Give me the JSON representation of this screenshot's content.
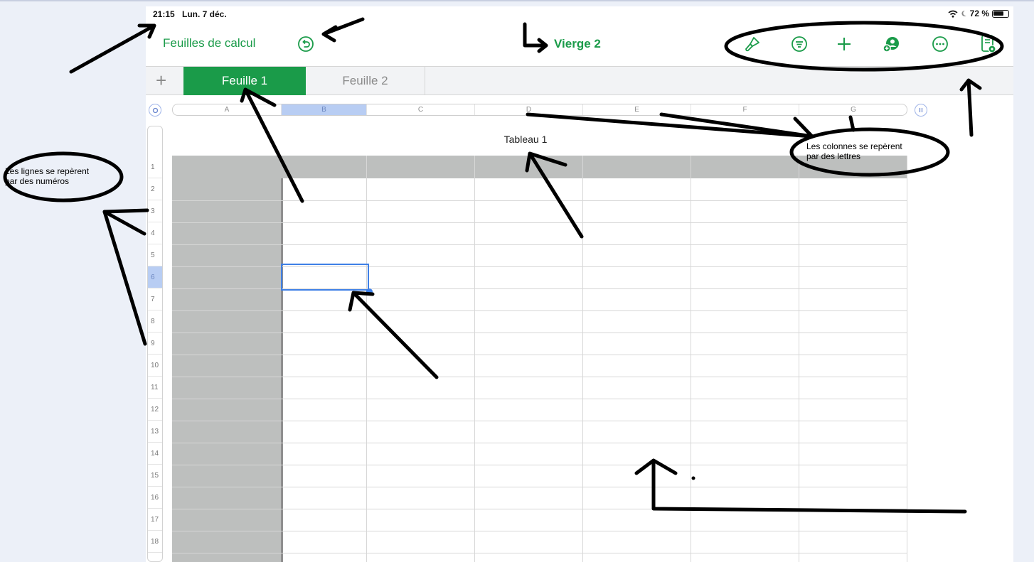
{
  "status_bar": {
    "time": "21:15",
    "date": "Lun. 7 déc.",
    "battery": "72 %"
  },
  "nav": {
    "back_label": "Feuilles de calcul",
    "doc_title": "Vierge 2"
  },
  "toolbar": {
    "icons": [
      "format-brush-icon",
      "filter-icon",
      "add-icon",
      "collaborate-icon",
      "more-icon",
      "preview-icon"
    ],
    "accent_color": "#1a9b49"
  },
  "tabs": {
    "add_label": "+",
    "items": [
      {
        "label": "Feuille 1",
        "active": true
      },
      {
        "label": "Feuille 2",
        "active": false
      }
    ]
  },
  "grid": {
    "columns": [
      "A",
      "B",
      "C",
      "D",
      "E",
      "F",
      "G"
    ],
    "selected_column": "B",
    "rows": [
      "1",
      "2",
      "3",
      "4",
      "5",
      "6",
      "7",
      "8",
      "9",
      "10",
      "11",
      "12",
      "13",
      "14",
      "15",
      "16",
      "17",
      "18"
    ],
    "selected_row": "6",
    "selected_cell": "B6",
    "table_title": "Tableau 1",
    "selection_color": "#3f80e6"
  },
  "annotations": {
    "rows_note_line1": "Les lignes se repèrent",
    "rows_note_line2": "par des numéros",
    "cols_note_line1": "Les colonnes se repèrent",
    "cols_note_line2": "par des lettres"
  }
}
